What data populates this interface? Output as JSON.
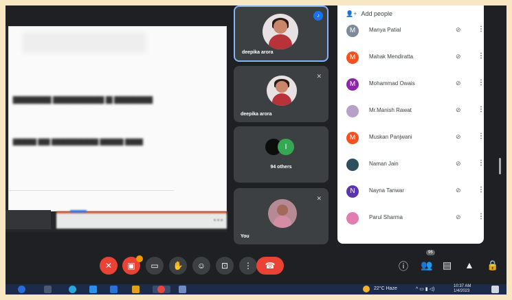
{
  "tiles": [
    {
      "name": "deepika arora",
      "mic": "speaking"
    },
    {
      "name": "deepika arora",
      "mic": "muted"
    },
    {
      "name": "94 others",
      "initial": "I"
    },
    {
      "name": "You",
      "mic": "muted"
    }
  ],
  "panel": {
    "add_people": "Add people",
    "people": [
      {
        "initial": "M",
        "name": "Manya Patial",
        "color": "#7d8a9a"
      },
      {
        "initial": "M",
        "name": "Mahak Mendiratta",
        "color": "#f4511e"
      },
      {
        "initial": "M",
        "name": "Mohammad Owais",
        "color": "#8e24aa"
      },
      {
        "initial": "",
        "name": "Mr.Manish Rawat",
        "color": "#b7a1c9"
      },
      {
        "initial": "M",
        "name": "Muskan Panjwani",
        "color": "#f4511e"
      },
      {
        "initial": "",
        "name": "Naman Jain",
        "color": "#2e4f5c"
      },
      {
        "initial": "N",
        "name": "Nayna Tanwar",
        "color": "#5e35b1"
      },
      {
        "initial": "",
        "name": "Parul Sharma",
        "color": "#e27bb0"
      }
    ]
  },
  "toolbar": {
    "participant_count": "96"
  },
  "taskbar": {
    "weather": "22°C Haze",
    "time": "10:37 AM",
    "date": "1/4/2023"
  }
}
